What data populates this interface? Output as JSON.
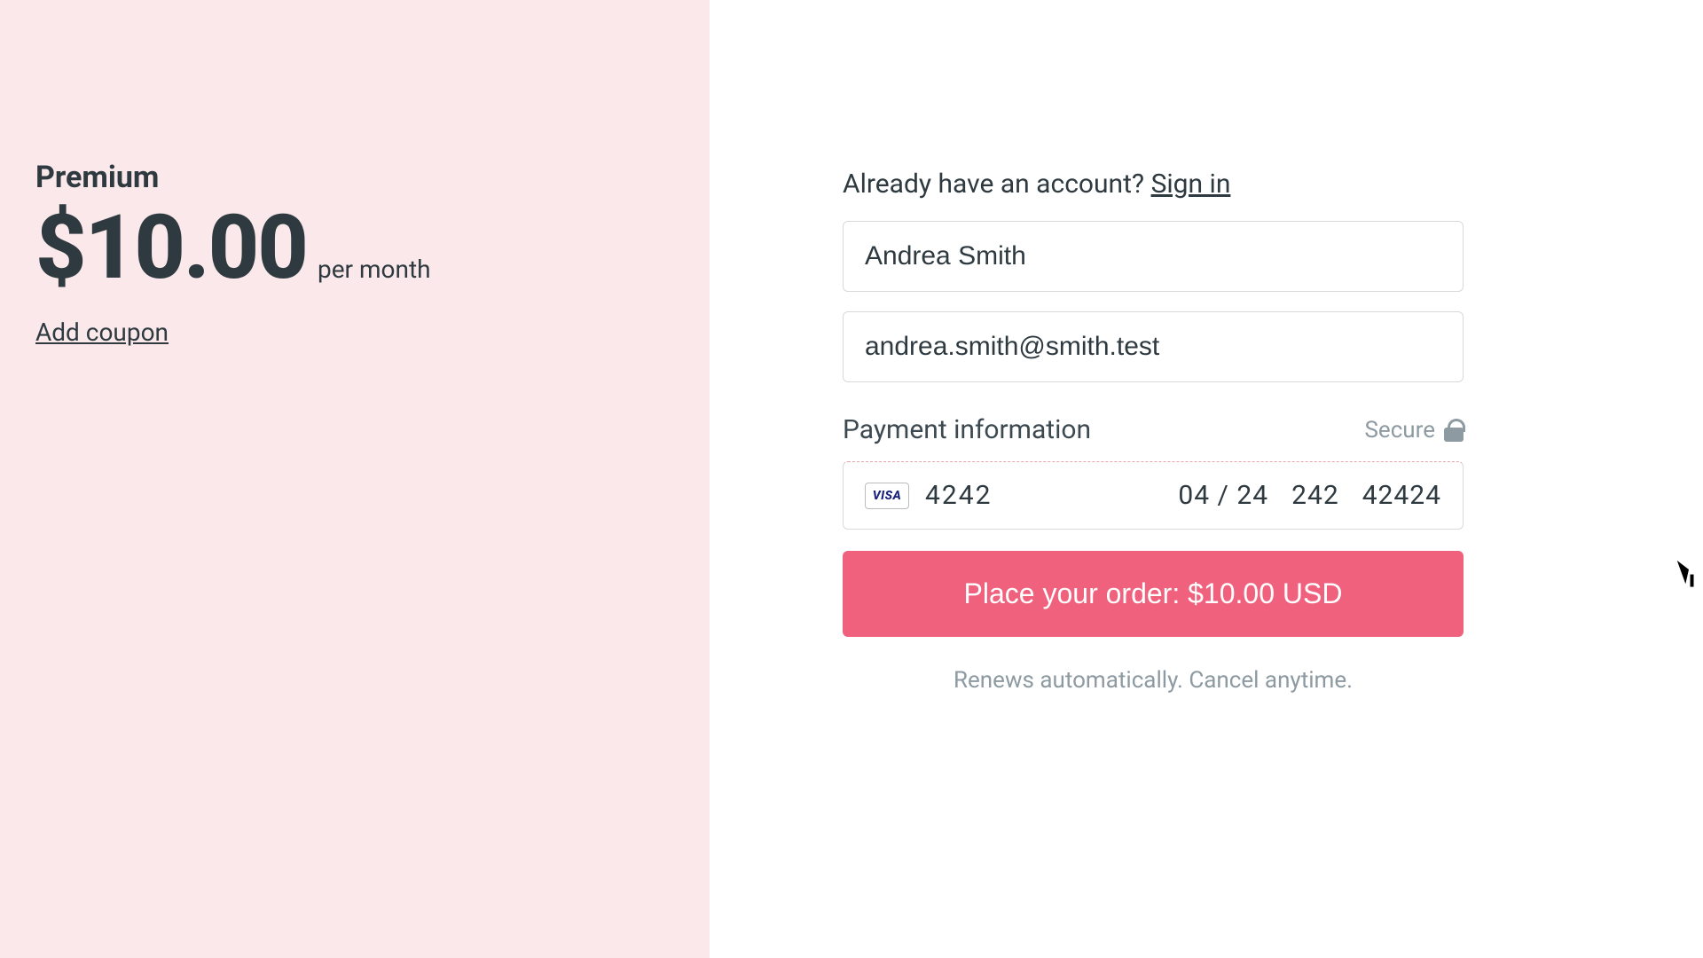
{
  "left": {
    "plan_name": "Premium",
    "price": "$10.00",
    "period": "per month",
    "coupon_link": "Add coupon"
  },
  "right": {
    "account_prompt": "Already have an account? ",
    "signin_label": "Sign in",
    "name_value": "Andrea Smith",
    "email_value": "andrea.smith@smith.test",
    "payment_title": "Payment information",
    "secure_label": "Secure",
    "card": {
      "brand": "VISA",
      "number": "4242",
      "expiry": "04 / 24",
      "cvc": "242",
      "zip": "42424"
    },
    "place_order_label": "Place your order: $10.00 USD",
    "renew_note": "Renews automatically. Cancel anytime."
  }
}
